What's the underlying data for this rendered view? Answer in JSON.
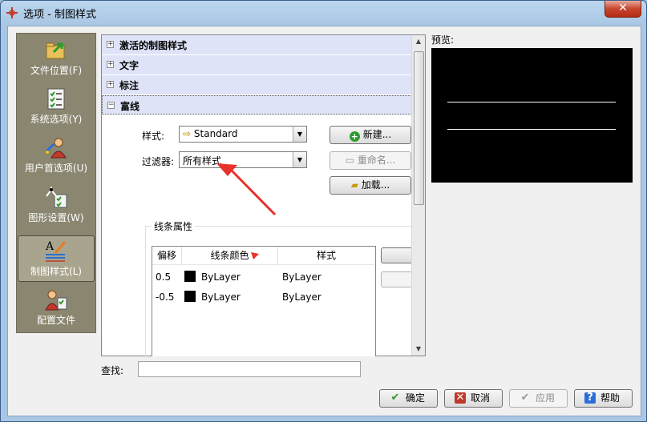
{
  "window": {
    "title": "选项 - 制图样式",
    "close": "✕"
  },
  "nav": {
    "items": [
      {
        "label": "文件位置(F)",
        "icon": "folder-arrow-icon"
      },
      {
        "label": "系统选项(Y)",
        "icon": "checklist-icon"
      },
      {
        "label": "用户首选项(U)",
        "icon": "user-preferences-icon"
      },
      {
        "label": "图形设置(W)",
        "icon": "graphics-settings-icon"
      },
      {
        "label": "制图样式(L)",
        "icon": "drafting-styles-icon"
      },
      {
        "label": "配置文件",
        "icon": "profiles-icon"
      }
    ],
    "selected": "制图样式(L)"
  },
  "tree": [
    {
      "label": "激活的制图样式",
      "expander": "+"
    },
    {
      "label": "文字",
      "expander": "+"
    },
    {
      "label": "标注",
      "expander": "+"
    },
    {
      "label": "富线",
      "expander": "−"
    }
  ],
  "mline": {
    "style_label": "样式:",
    "style_value": "Standard",
    "filter_label": "过滤器:",
    "filter_value": "所有样式",
    "new_button": "新建...",
    "rename_button": "重命名...",
    "load_button": "加载...",
    "group_title": "线条属性",
    "columns": [
      "偏移",
      "线条颜色",
      "样式"
    ],
    "rows": [
      {
        "offset": "0.5",
        "color": "ByLayer",
        "style": "ByLayer"
      },
      {
        "offset": "-0.5",
        "color": "ByLayer",
        "style": "ByLayer"
      }
    ]
  },
  "preview": {
    "label": "预览:"
  },
  "find": {
    "label": "查找:",
    "value": ""
  },
  "buttons": {
    "ok": "确定",
    "cancel": "取消",
    "apply": "应用",
    "help": "帮助"
  },
  "colors": {
    "annotation_arrow": "#e8322b",
    "preview_bg": "#000000",
    "tree_row_bg": "#dfe3f8",
    "nav_bg": "#8a8670"
  }
}
